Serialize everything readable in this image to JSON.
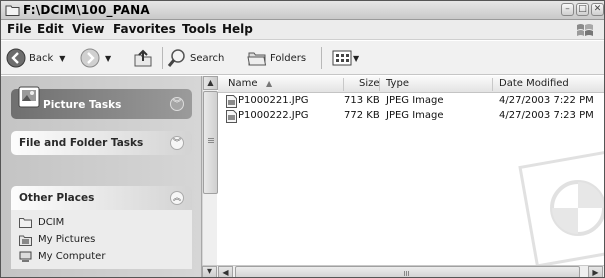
{
  "window": {
    "title": "F:\\DCIM\\100_PANA",
    "controls": [
      "minimize",
      "maximize",
      "close"
    ]
  },
  "menubar": {
    "items": [
      "File",
      "Edit",
      "View",
      "Favorites",
      "Tools",
      "Help"
    ]
  },
  "toolbar": {
    "back_label": "Back",
    "search_label": "Search",
    "folders_label": "Folders",
    "icons": [
      "back-arrow-icon",
      "forward-arrow-icon",
      "up-folder-icon",
      "search-icon",
      "folders-icon",
      "views-icon"
    ]
  },
  "taskpane": {
    "picture_tasks": "Picture Tasks",
    "file_folder_tasks": "File and Folder Tasks",
    "other_places": {
      "title": "Other Places",
      "items": [
        {
          "label": "DCIM",
          "icon": "folder-icon"
        },
        {
          "label": "My Pictures",
          "icon": "pictures-folder-icon"
        },
        {
          "label": "My Computer",
          "icon": "computer-icon"
        }
      ]
    }
  },
  "file_list": {
    "columns": [
      "Name",
      "Size",
      "Type",
      "Date Modified"
    ],
    "sort_indicator": "▲",
    "rows": [
      {
        "name": "P1000221.JPG",
        "size": "713 KB",
        "type": "JPEG Image",
        "date": "4/27/2003 7:22 PM"
      },
      {
        "name": "P1000222.JPG",
        "size": "772 KB",
        "type": "JPEG Image",
        "date": "4/27/2003 7:23 PM"
      }
    ]
  },
  "colors": {
    "picture_tasks_header": "#7a7a7a",
    "task_pane_bg": "#cdcdcd"
  }
}
